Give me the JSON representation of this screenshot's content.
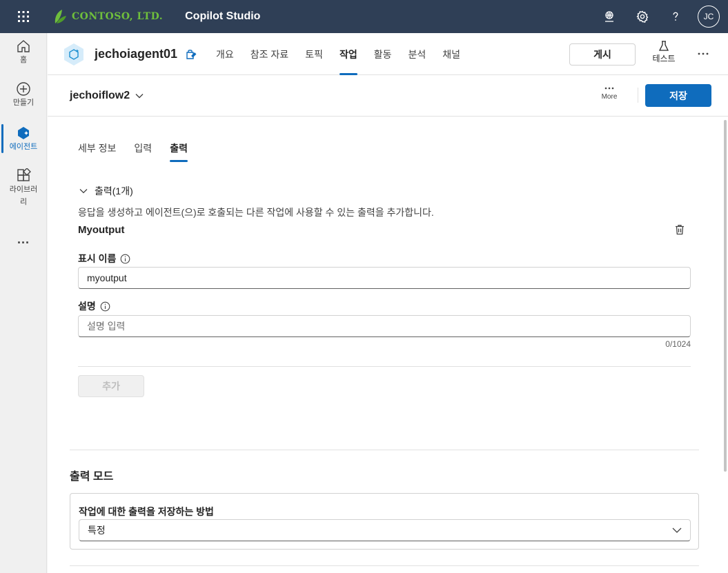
{
  "topbar": {
    "logo_text": "CONTOSO, LTD.",
    "app_title": "Copilot Studio",
    "avatar_initials": "JC",
    "icons": [
      "waffle-icon",
      "environment-icon",
      "settings-icon",
      "help-icon"
    ]
  },
  "rail": {
    "items": [
      {
        "label": "홈",
        "icon": "home-icon"
      },
      {
        "label": "만들기",
        "icon": "create-icon"
      },
      {
        "label": "에이전트",
        "icon": "agents-icon",
        "active": true
      },
      {
        "label": "라이브러리",
        "icon": "library-icon"
      },
      {
        "label": "...",
        "icon": "more-icon"
      }
    ]
  },
  "agent": {
    "name": "jechoiagent01",
    "tabs": [
      {
        "label": "개요"
      },
      {
        "label": "참조 자료"
      },
      {
        "label": "토픽"
      },
      {
        "label": "작업",
        "active": true
      },
      {
        "label": "활동"
      },
      {
        "label": "분석"
      },
      {
        "label": "채널"
      }
    ],
    "publish_label": "게시",
    "test_label": "테스트"
  },
  "flow": {
    "name": "jechoiflow2",
    "more_label": "More",
    "save_label": "저장"
  },
  "subtabs": [
    {
      "label": "세부 정보"
    },
    {
      "label": "입력"
    },
    {
      "label": "출력",
      "active": true
    }
  ],
  "outputs": {
    "section_label": "출력(1개)",
    "description": "응답을 생성하고 에이전트(으)로 호출되는 다른 작업에 사용할 수 있는 출력을 추가합니다.",
    "item_title": "Myoutput",
    "display_name_label": "표시 이름",
    "display_name_value": "myoutput",
    "description_label": "설명",
    "description_placeholder": "설명 입력",
    "description_count": "0/1024",
    "add_label": "추가"
  },
  "output_mode": {
    "title": "출력 모드",
    "field_label": "작업에 대한 출력을 저장하는 방법",
    "selected": "특정"
  },
  "colors": {
    "topbar": "#2f3f56",
    "accent": "#0f6cbd",
    "logo": "#6fbf3c"
  }
}
